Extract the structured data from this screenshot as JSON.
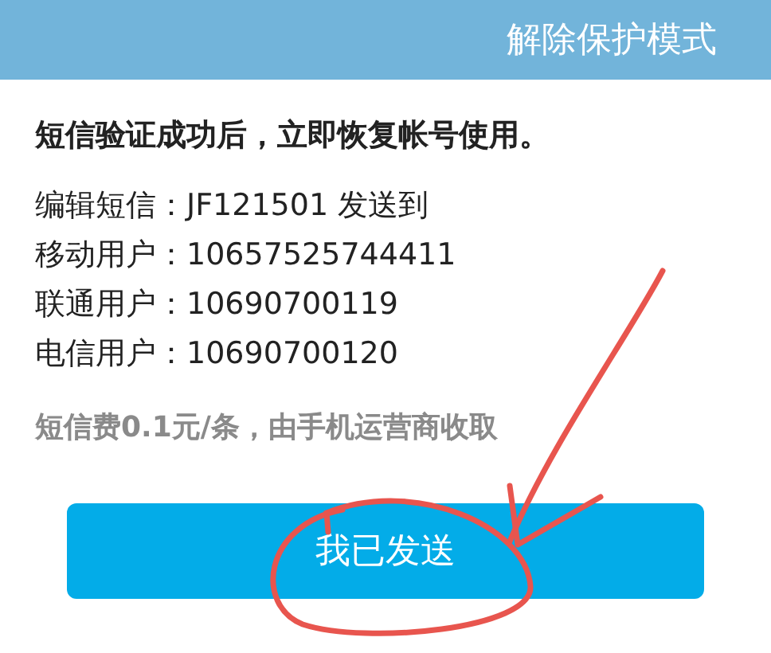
{
  "header": {
    "title": "解除保护模式"
  },
  "headline": "短信验证成功后，立即恢复帐号使用。",
  "instructions": [
    "编辑短信：JF121501 发送到",
    "移动用户：10657525744411",
    "联通用户：10690700119",
    "电信用户：10690700120"
  ],
  "fee_note": "短信费0.1元/条，由手机运营商收取",
  "button": {
    "label": "我已发送"
  }
}
